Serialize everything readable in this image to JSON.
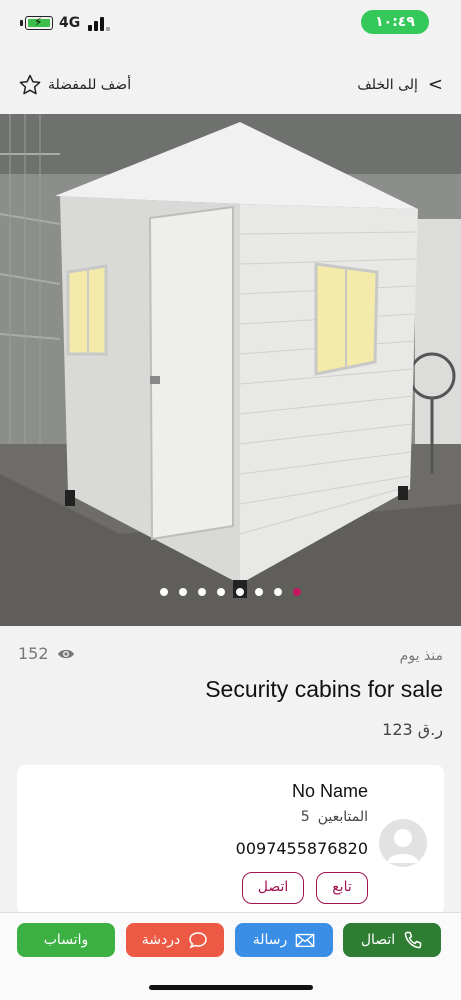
{
  "status_bar": {
    "network": "4G",
    "time": "١٠:٤٩",
    "battery_color": "#3bbf4a",
    "time_pill_color": "#34c759"
  },
  "nav": {
    "back_label": "إلى الخلف",
    "favorite_label": "أضف للمفضلة"
  },
  "gallery": {
    "image_count": 8,
    "active_index": 7,
    "active_dot_color": "#c2185b"
  },
  "listing": {
    "views": "152",
    "posted": "منذ يوم",
    "title": "Security cabins for sale",
    "price": "123 ر.ق"
  },
  "seller": {
    "name": "No Name",
    "followers_label": "المتابعين",
    "followers_count": "5",
    "phone": "0097455876820",
    "follow_label": "تابع",
    "call_label": "اتصل"
  },
  "actions": {
    "whatsapp": "واتساب",
    "chat": "دردشة",
    "message": "رسالة",
    "call": "اتصال"
  },
  "colors": {
    "accent": "#a0124f",
    "whatsapp": "#3cb043",
    "chat": "#ec5a46",
    "message": "#3a8ee6",
    "call": "#2e7d32"
  }
}
